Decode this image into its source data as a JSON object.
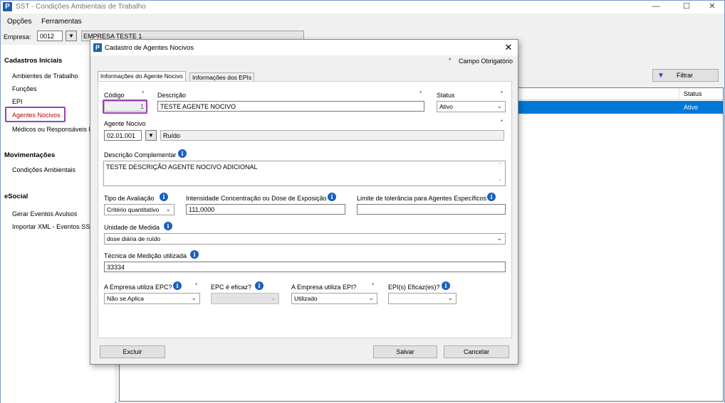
{
  "window": {
    "title": "SST - Condições Ambientais de Trabalho",
    "logo": "P"
  },
  "menu": {
    "opcoes": "Opções",
    "ferramentas": "Ferramentas"
  },
  "empresa": {
    "label": "Empresa:",
    "code": "0012",
    "name": "EMPRESA TESTE 1"
  },
  "sidebar": {
    "section1": "Cadastros Iniciais",
    "items1": [
      "Ambientes de Trabalho",
      "Funções",
      "EPI",
      "Agentes Nocivos",
      "Médicos ou Responsáveis PC"
    ],
    "section2": "Movimentações",
    "items2": [
      "Condições Ambientais"
    ],
    "section3": "eSocial",
    "items3": [
      "Gerar Eventos Avulsos",
      "Importar XML - Eventos SST"
    ]
  },
  "content": {
    "filtrar": "Filtrar",
    "grid_header_status": "Status",
    "grid_row_status": "Ativo"
  },
  "dialog": {
    "title": "Cadastro de Agentes Nocivos",
    "logo": "P",
    "required_star": "*",
    "required_label": "Campo Obrigatório",
    "tabs": [
      "Informações do Agente Nocivo",
      "Informações dos EPIs"
    ],
    "codigo_label": "Código",
    "codigo_value": "1",
    "descricao_label": "Descrição",
    "descricao_value": "TESTE AGENTE NOCIVO",
    "status_label": "Status",
    "status_value": "Ativo",
    "agente_label": "Agente Nocivo",
    "agente_code": "02.01.001",
    "agente_name": "Ruído",
    "desc_comp_label": "Descrição Complementar",
    "desc_comp_value": "TESTE DESCRIÇÃO AGENTE NOCIVO ADICIONAL",
    "tipo_aval_label": "Tipo de Avaliação",
    "tipo_aval_value": "Critério quantitativo",
    "intensidade_label": "Intensidade Concentração ou Dose de Exposição",
    "intensidade_value": "111,0000",
    "limite_label": "Limite de tolerância para Agentes Específicos",
    "limite_value": "",
    "unidade_label": "Unidade de Medida",
    "unidade_value": "dose diária de ruído",
    "tecnica_label": "Técnica de Medição utilizada",
    "tecnica_value": "33334",
    "epc_label": "A Empresa utiliza EPC?",
    "epc_value": "Não se Aplica",
    "epc_eficaz_label": "EPC é eficaz?",
    "epi_label": "A Empresa utiliza EPI?",
    "epi_value": "Utilizado",
    "epi_eficaz_label": "EPI(s) Eficaz(es)?",
    "btn_excluir": "Excluir",
    "btn_salvar": "Salvar",
    "btn_cancelar": "Cancelar"
  },
  "colors": {
    "accent": "#0078d7",
    "required": "#c00000",
    "highlight": "#9b3fb5",
    "info_icon": "#1c5fbf"
  }
}
